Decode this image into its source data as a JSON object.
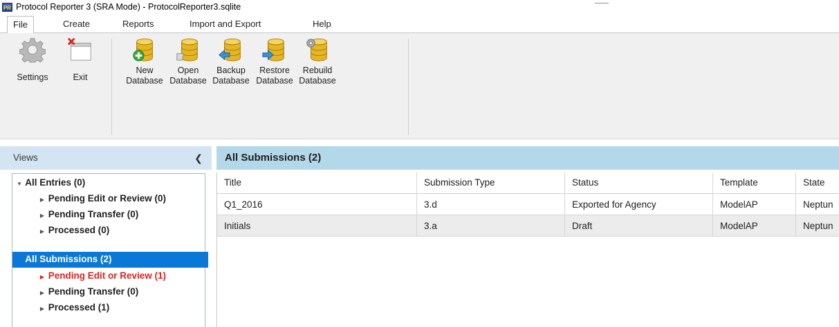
{
  "window": {
    "title": "Protocol Reporter 3 (SRA Mode) - ProtocolReporter3.sqlite",
    "icon_text": "PR"
  },
  "menu": {
    "tabs": [
      {
        "label": "File"
      },
      {
        "label": "Create"
      },
      {
        "label": "Reports"
      },
      {
        "label": "Import and Export"
      },
      {
        "label": "Help"
      }
    ]
  },
  "ribbon": {
    "buttons": [
      {
        "label": "Settings",
        "icon": "gear-icon"
      },
      {
        "label": "Exit",
        "icon": "exit-window-icon"
      },
      {
        "line1": "New",
        "line2": "Database",
        "icon": "new-database-icon"
      },
      {
        "line1": "Open",
        "line2": "Database",
        "icon": "open-database-icon"
      },
      {
        "line1": "Backup",
        "line2": "Database",
        "icon": "backup-database-icon"
      },
      {
        "line1": "Restore",
        "line2": "Database",
        "icon": "restore-database-icon"
      },
      {
        "line1": "Rebuild",
        "line2": "Database",
        "icon": "rebuild-database-icon"
      }
    ]
  },
  "views": {
    "title": "Views",
    "tree": [
      {
        "label": "All Entries (0)"
      },
      {
        "label": "Pending Edit or Review (0)"
      },
      {
        "label": "Pending Transfer (0)"
      },
      {
        "label": "Processed (0)"
      },
      {
        "label": "All Submissions (2)"
      },
      {
        "label": "Pending Edit or Review (1)"
      },
      {
        "label": "Pending Transfer (0)"
      },
      {
        "label": "Processed (1)"
      }
    ]
  },
  "main": {
    "title": "All Submissions (2)",
    "columns": [
      "Title",
      "Submission Type",
      "Status",
      "Template",
      "State"
    ],
    "rows": [
      [
        "Q1_2016",
        "3.d",
        "Exported for Agency",
        "ModelAP",
        "Neptun"
      ],
      [
        "Initials",
        "3.a",
        "Draft",
        "ModelAP",
        "Neptun"
      ]
    ]
  },
  "colors": {
    "selected": "#0a78d7",
    "alert": "#e0211d",
    "main_header": "#b3d8e9",
    "views_header": "#d3e4f3",
    "database_gold": "#e6b523"
  }
}
